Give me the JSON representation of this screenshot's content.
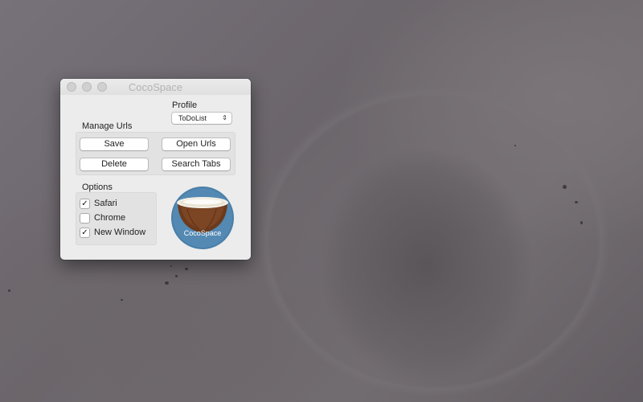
{
  "window": {
    "title": "CocoSpace"
  },
  "profile": {
    "label": "Profile",
    "selected": "ToDoList"
  },
  "manage_urls": {
    "label": "Manage Urls",
    "save": "Save",
    "open_urls": "Open Urls",
    "delete": "Delete",
    "search_tabs": "Search Tabs"
  },
  "options": {
    "label": "Options",
    "items": [
      {
        "label": "Safari",
        "checked": true
      },
      {
        "label": "Chrome",
        "checked": false
      },
      {
        "label": "New Window",
        "checked": true
      }
    ]
  },
  "logo": {
    "text": "CocoSpace",
    "bg_color": "#4a7fa8",
    "shell_color": "#6b3a1d"
  },
  "icons": {
    "check": "✓",
    "chevron": "⌃⌄"
  }
}
